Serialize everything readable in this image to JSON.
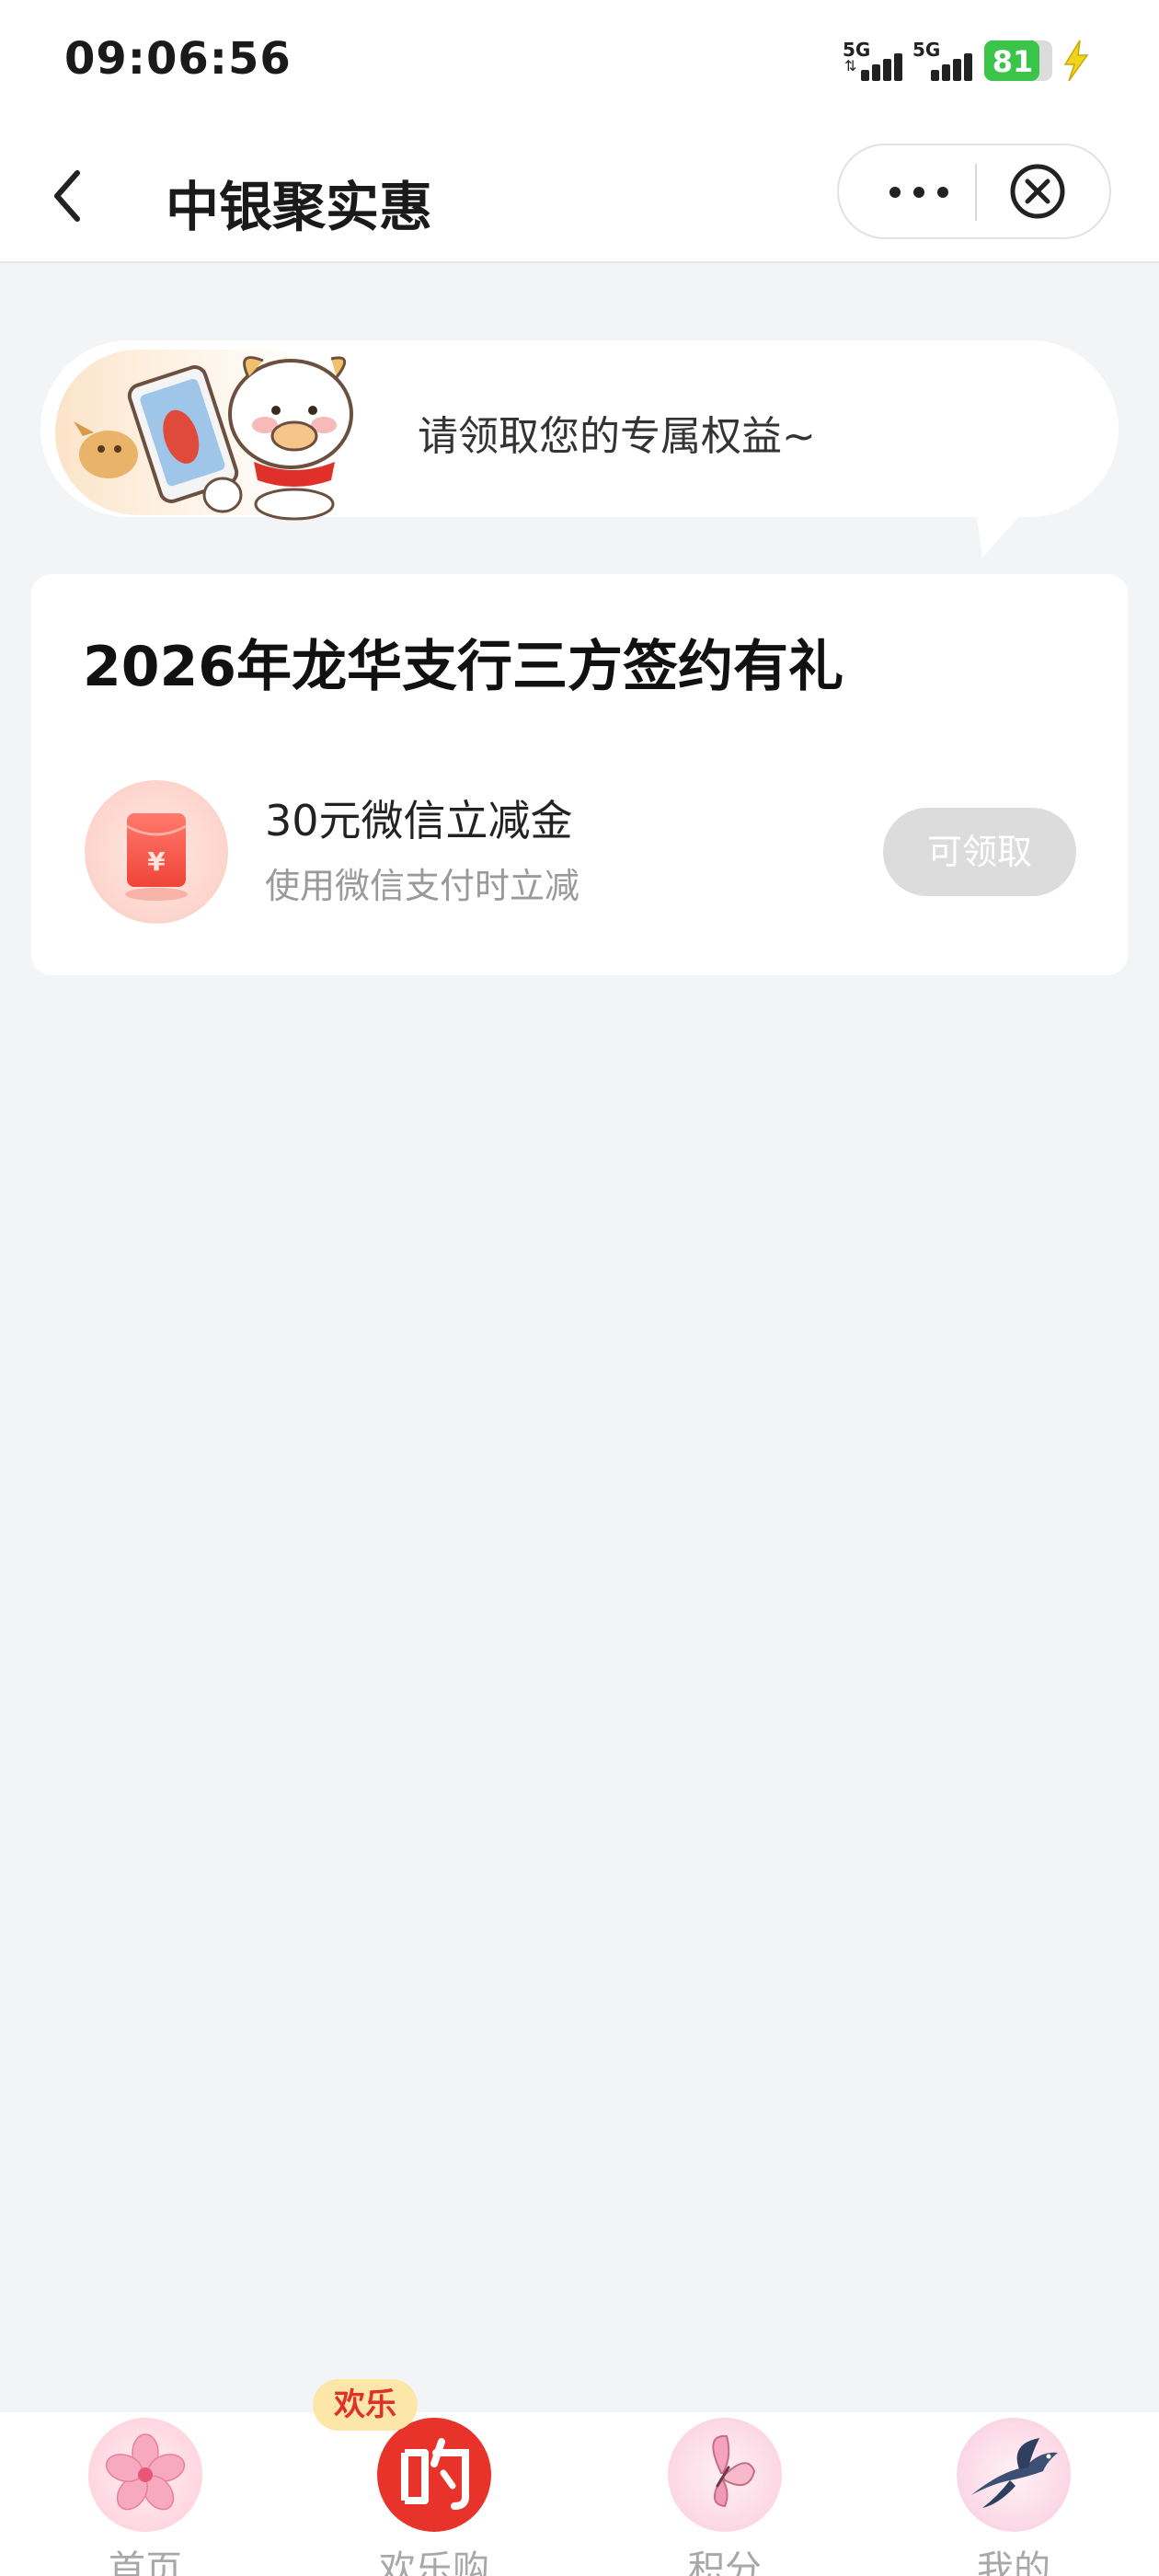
{
  "status_bar": {
    "time": "09:06:56",
    "signal_1_label": "5G",
    "signal_2_label": "5G",
    "battery_level": "81",
    "battery_fraction": 0.81,
    "charging": true
  },
  "nav": {
    "title": "中银聚实惠"
  },
  "banner": {
    "text": "请领取您的专属权益~"
  },
  "card": {
    "title": "2026年龙华支行三方签约有礼",
    "reward": {
      "name": "30元微信立减金",
      "description": "使用微信支付时立减",
      "button_label": "可领取",
      "icon": "red-envelope-icon"
    }
  },
  "tabs": [
    {
      "label": "首页",
      "icon": "cherry-blossom-icon"
    },
    {
      "label": "欢乐购",
      "icon": "shopping-bag-icon",
      "badge": "欢乐"
    },
    {
      "label": "积分",
      "icon": "butterfly-icon"
    },
    {
      "label": "我的",
      "icon": "swallow-icon"
    }
  ],
  "colors": {
    "background": "#f3f4f6",
    "battery_green": "#3ac54a",
    "brand_red": "#e0302a",
    "button_disabled": "#dcdcdc"
  }
}
